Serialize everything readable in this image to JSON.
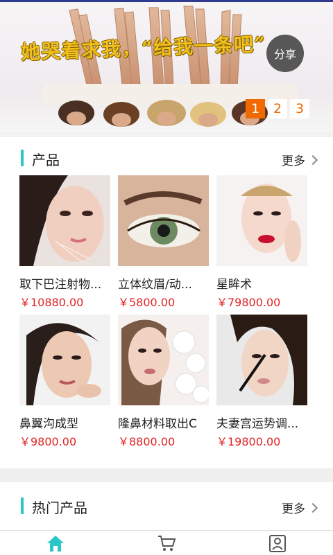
{
  "banner": {
    "caption": "她哭着求我，“给我一条吧”",
    "share_label": "分享",
    "pages": [
      "1",
      "2",
      "3"
    ],
    "active_page": "1"
  },
  "products_section": {
    "title": "产品",
    "more_label": "更多",
    "items": [
      {
        "name": "取下巴注射物...",
        "price": "￥10880.00"
      },
      {
        "name": "立体纹眉/动...",
        "price": "￥5800.00"
      },
      {
        "name": "星眸术",
        "price": "￥79800.00"
      },
      {
        "name": "鼻翼沟成型",
        "price": "￥9800.00"
      },
      {
        "name": "隆鼻材料取出C",
        "price": "￥8800.00"
      },
      {
        "name": "夫妻宫运势调...",
        "price": "￥19800.00"
      }
    ]
  },
  "hot_section": {
    "title": "热门产品",
    "more_label": "更多"
  },
  "bottom_nav": {
    "items": [
      {
        "icon": "home-icon",
        "active": true
      },
      {
        "icon": "cart-icon",
        "active": false
      },
      {
        "icon": "profile-icon",
        "active": false
      }
    ],
    "active_color": "#2cc6c9",
    "inactive_color": "#555555"
  },
  "colors": {
    "accent": "#2cc6c9",
    "price": "#e02424",
    "pager_active": "#f06a00"
  }
}
